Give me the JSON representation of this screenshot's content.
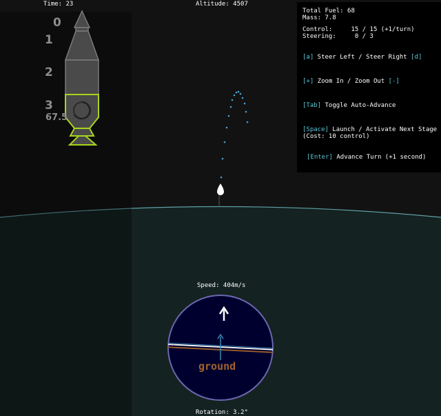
{
  "hud": {
    "time": "Time: 23",
    "altitude": "Altitude: 4507",
    "speed": "Speed: 404m/s",
    "rotation": "Rotation: 3.2°"
  },
  "info": {
    "total_fuel": "Total Fuel: 68",
    "mass": "Mass: 7.8",
    "control": "Control:     15 / 15 (+1/turn)",
    "steering": "Steering:     0 / 3",
    "steer": {
      "key_left": "[a]",
      "text": " Steer Left / Steer Right ",
      "key_right": "[d]"
    },
    "zoom": {
      "key_in": "[+]",
      "text": " Zoom In / Zoom Out ",
      "key_out": "[-]"
    },
    "auto": {
      "key": "[Tab]",
      "text": " Toggle Auto-Advance"
    },
    "launch": {
      "key": "[Space]",
      "text": " Launch / Activate Next Stage",
      "cost": "(Cost: 10 control)"
    },
    "advance": {
      "key": "[Enter]",
      "text": " Advance Turn (+1 second)"
    }
  },
  "stages": {
    "numbers": [
      "0",
      "1",
      "2",
      "3"
    ],
    "fuel": "67.5"
  },
  "navball": {
    "ground_label": "ground"
  },
  "colors": {
    "sky": "#121212",
    "ground": "#142221",
    "horizon": "#5f9fa6",
    "active_stage": "#a8d41c",
    "stage_gray": "#7a7a7a",
    "key_cyan": "#5bc6d6",
    "trajectory": "#4a9fd0",
    "navball": "#00002e",
    "navball_ring": "#6b67b0",
    "ground_text": "#a0612b"
  },
  "icons": [
    "rocket-icon",
    "drop-icon",
    "arrow-up-icon"
  ]
}
